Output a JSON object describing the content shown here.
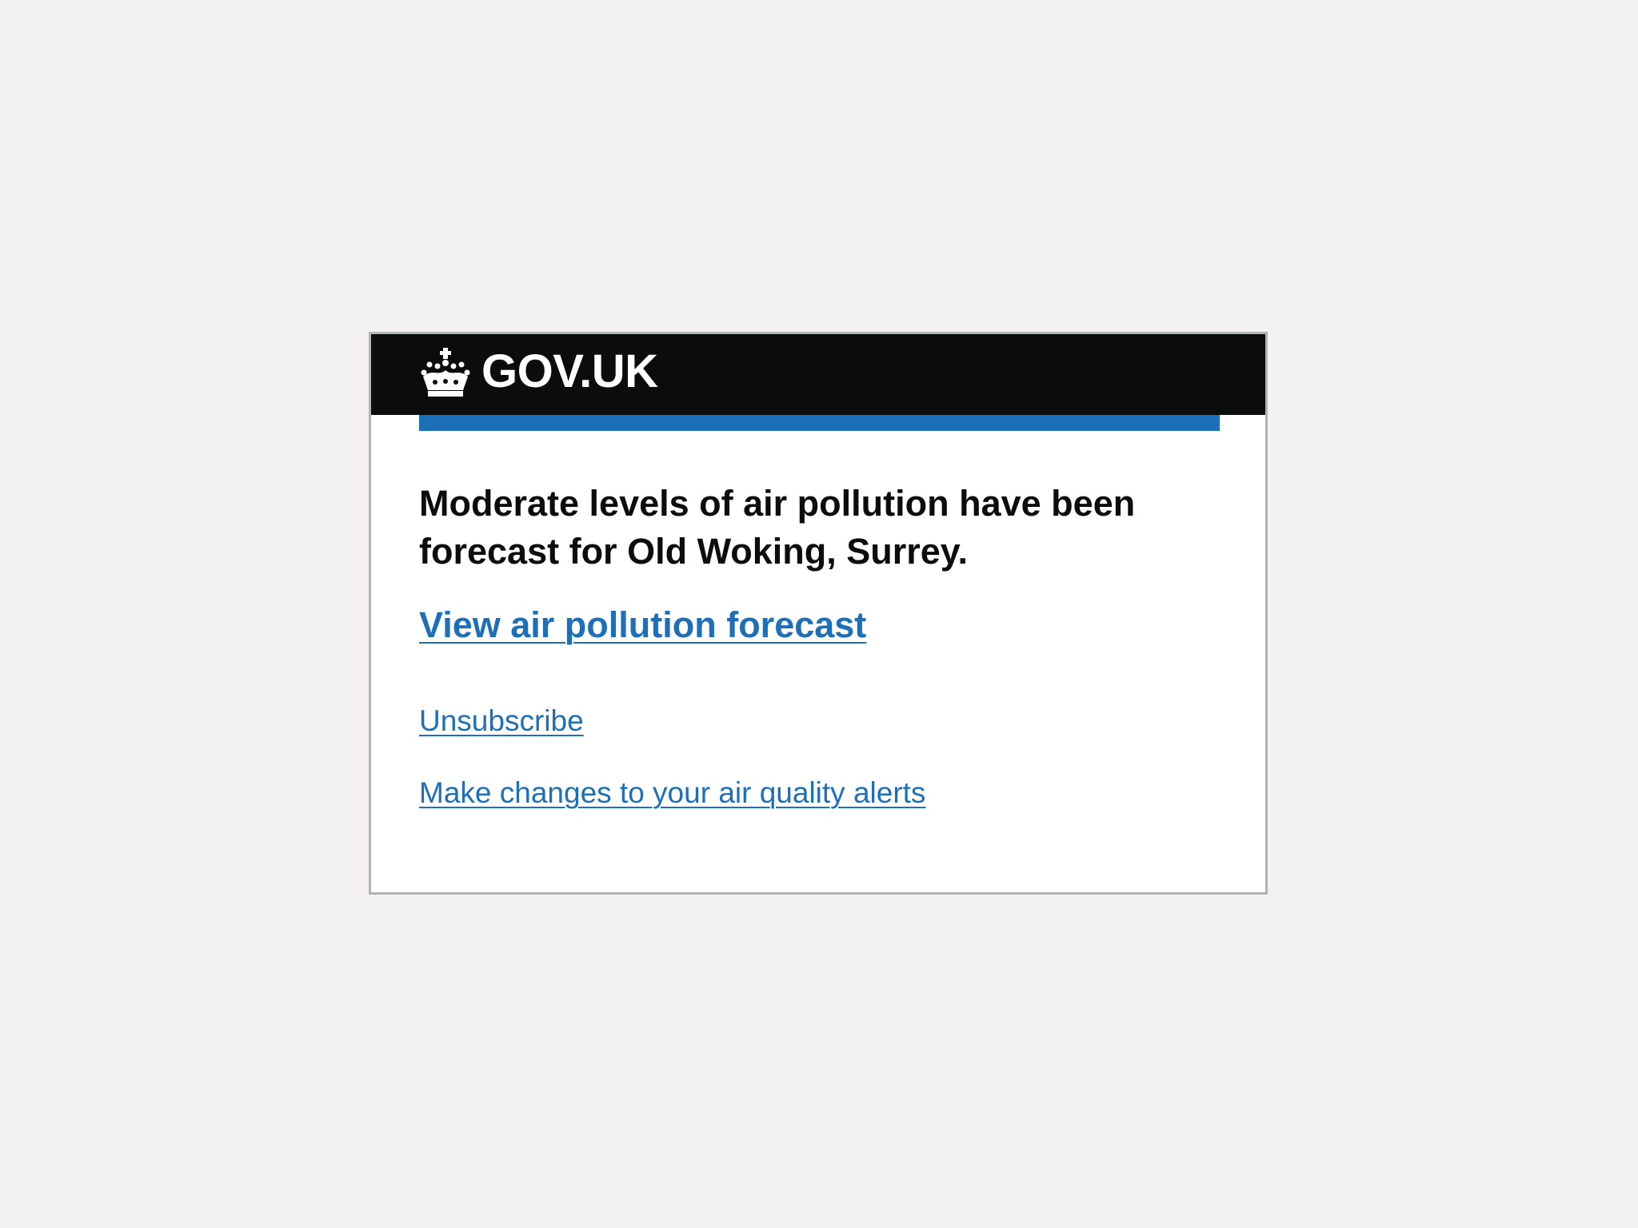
{
  "header": {
    "brand": "GOV.UK",
    "crown_icon": "crown-icon",
    "background_color": "#0b0c0c",
    "accent_color": "#1d70b8"
  },
  "message": {
    "text": "Moderate levels of air pollution have been forecast for Old Woking, Surrey."
  },
  "links": {
    "forecast": "View air pollution forecast",
    "unsubscribe": "Unsubscribe",
    "alerts": "Make changes to your air quality alerts",
    "link_color": "#1d70b8"
  }
}
